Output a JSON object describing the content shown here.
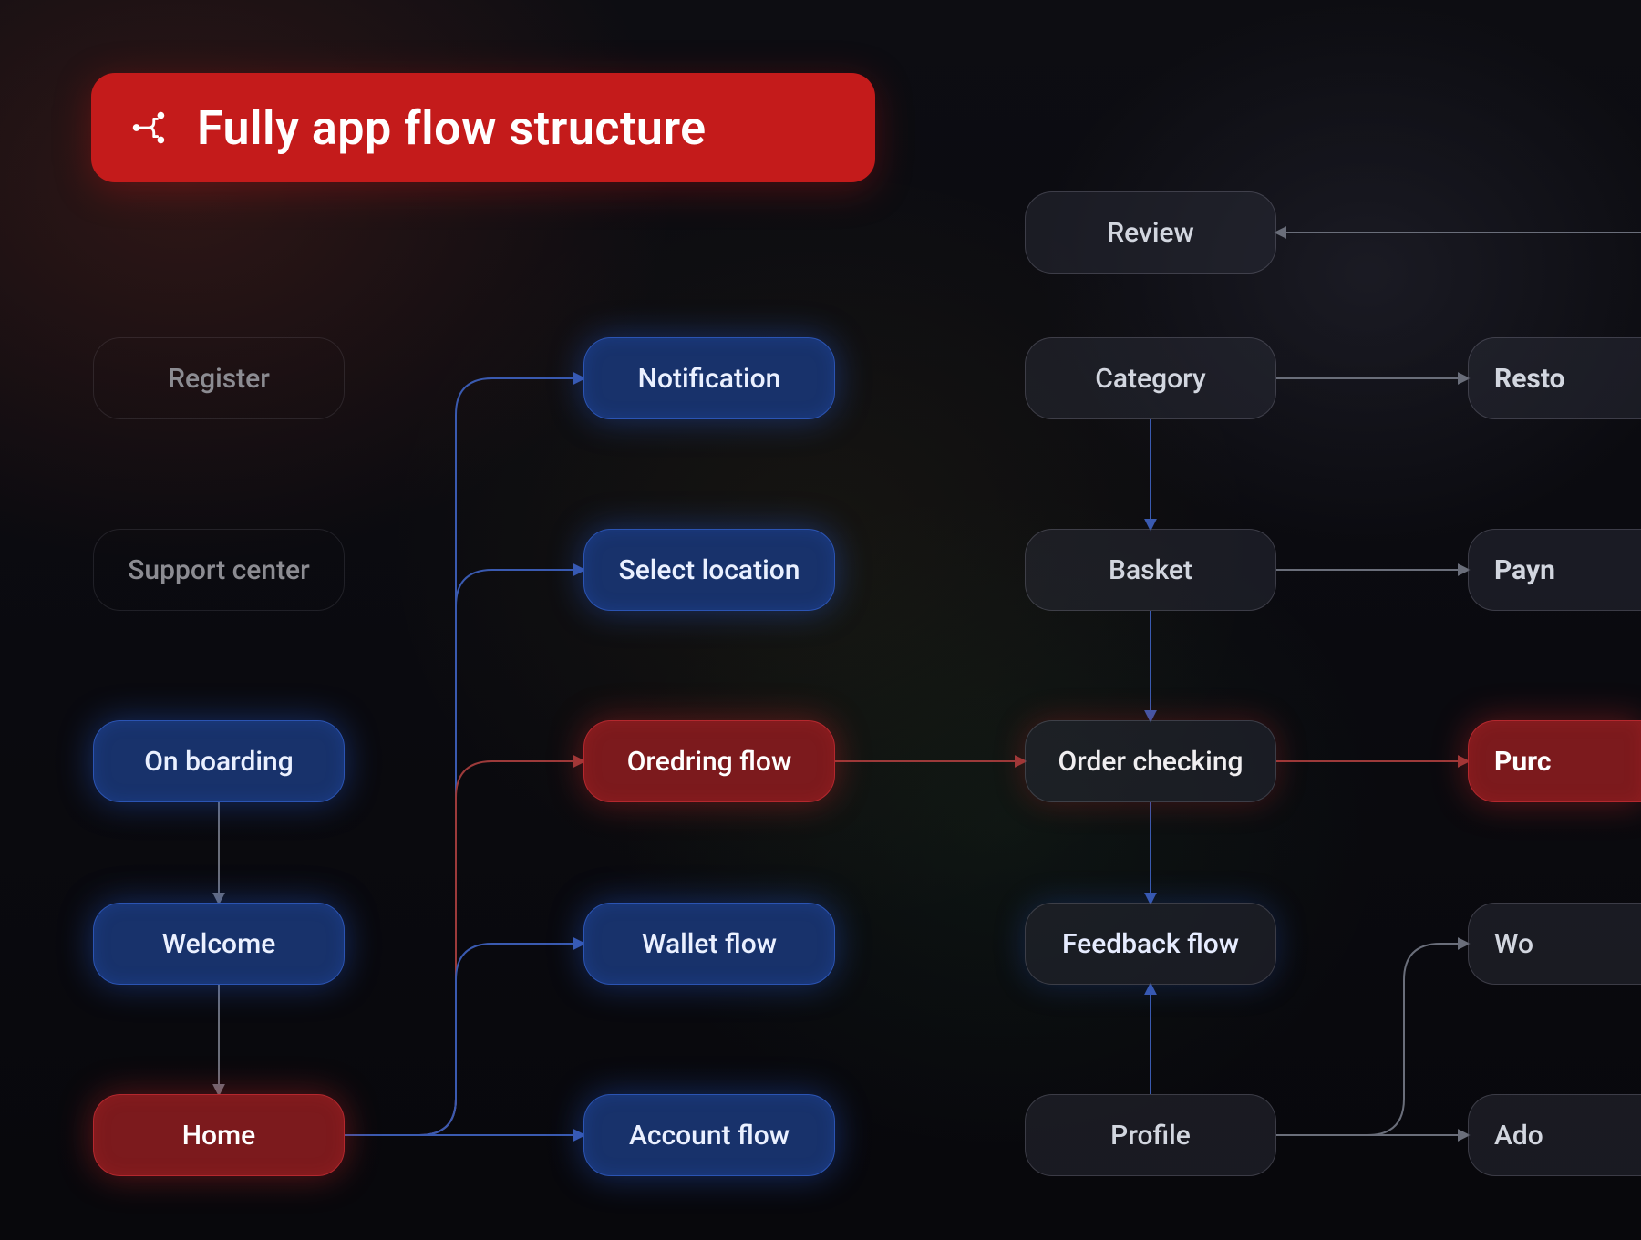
{
  "title": "Fully app flow structure",
  "nodes": {
    "register": "Register",
    "support_center": "Support center",
    "on_boarding": "On boarding",
    "welcome": "Welcome",
    "home": "Home",
    "notification": "Notification",
    "select_location": "Select location",
    "ordering_flow": "Oredring flow",
    "wallet_flow": "Wallet flow",
    "account_flow": "Account flow",
    "review": "Review",
    "category": "Category",
    "basket": "Basket",
    "order_checking": "Order checking",
    "feedback_flow": "Feedback flow",
    "profile": "Profile",
    "restaurant": "Resto",
    "payment": "Payn",
    "purchase": "Purc",
    "wallet_col5": "Wo",
    "address_col5": "Ado"
  },
  "colors": {
    "title_bg": "#c41b1b",
    "blue": "#18326b",
    "red": "#7c1a1d"
  }
}
